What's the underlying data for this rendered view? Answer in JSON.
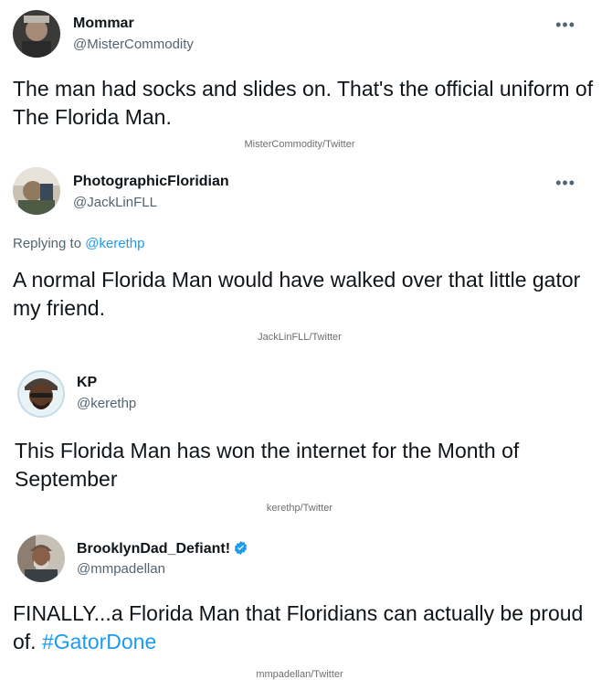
{
  "tweets": [
    {
      "name": "Mommar",
      "handle": "@MisterCommodity",
      "more": "•••",
      "body": "The man had socks and slides on. That's the official uniform of The Florida Man.",
      "credit": "MisterCommodity/Twitter"
    },
    {
      "name": "PhotographicFloridian",
      "handle": "@JackLinFLL",
      "more": "•••",
      "replying_prefix": "Replying to",
      "replying_mention": "@kerethp",
      "body": "A normal Florida Man would have walked over that little gator my friend.",
      "credit": "JackLinFLL/Twitter"
    },
    {
      "name": "KP",
      "handle": "@kerethp",
      "body": "This Florida Man has won the internet for the Month of September",
      "credit": "kerethp/Twitter"
    },
    {
      "name": "BrooklynDad_Defiant!",
      "handle": "@mmpadellan",
      "body": "FINALLY...a Florida Man that Floridians can actually be proud of.",
      "hashtag": "#GatorDone",
      "credit": "mmpadellan/Twitter"
    }
  ],
  "colors": {
    "link": "#1d9bf0",
    "secondary_text": "#536471",
    "primary_text": "#0f1419"
  }
}
